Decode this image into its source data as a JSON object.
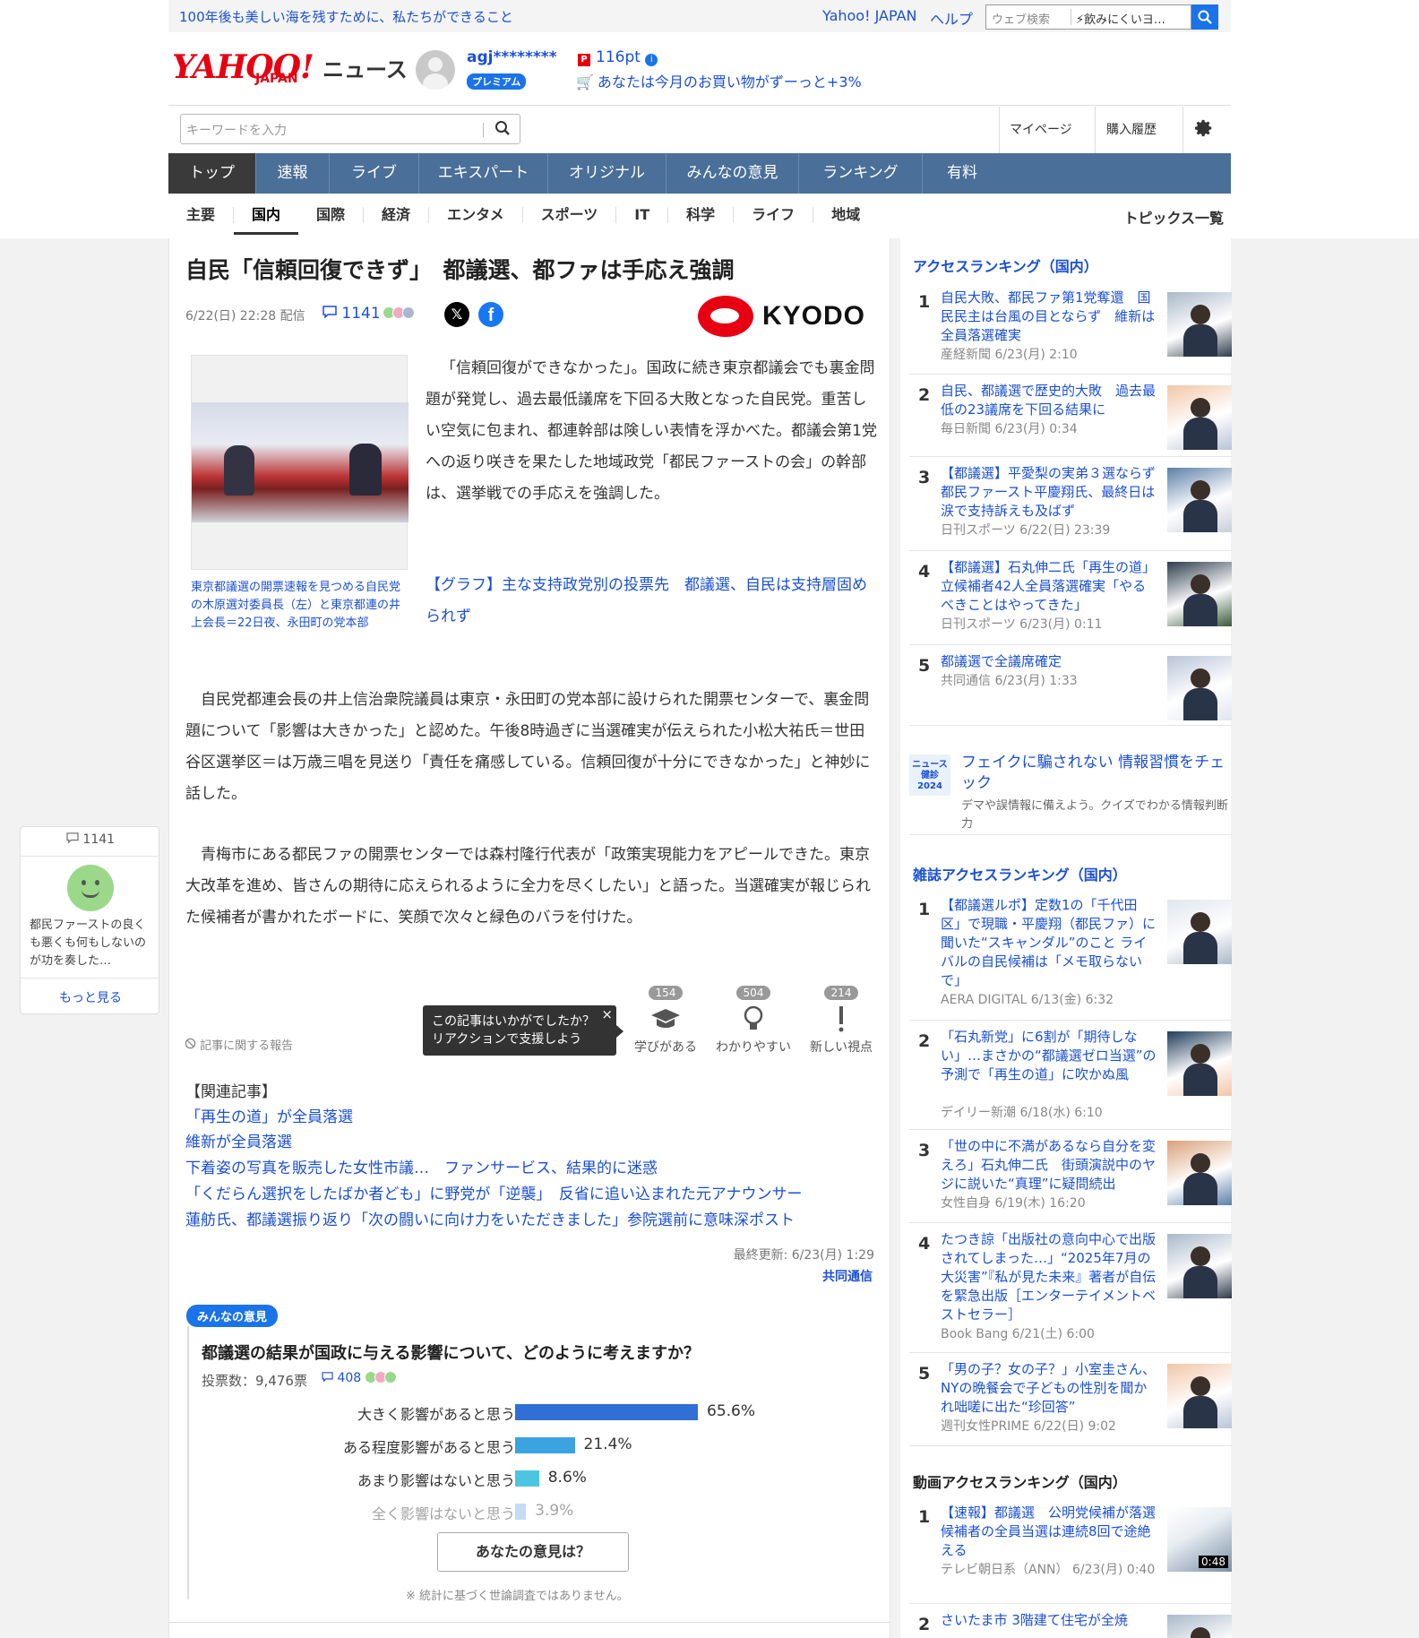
{
  "topbar": {
    "promo": "100年後も美しい海を残すために、私たちができること",
    "yahoo_japan": "Yahoo! JAPAN",
    "help": "ヘルプ",
    "search_placeholder": "ウェブ検索",
    "search_suggest": "飲みにくいヨ…"
  },
  "header": {
    "logo": "YAHOO!",
    "logo_sub": "JAPAN",
    "service": "ニュース",
    "username": "agj********",
    "premium": "プレミアム",
    "points": "116pt",
    "shopping": "あなたは今月のお買い物がずーっと+3%",
    "keyword_placeholder": "キーワードを入力",
    "mypage": "マイページ",
    "purchase_history": "購入履歴"
  },
  "nav": {
    "items": [
      "トップ",
      "速報",
      "ライブ",
      "エキスパート",
      "オリジナル",
      "みんなの意見",
      "ランキング",
      "有料"
    ]
  },
  "subnav": {
    "items": [
      "主要",
      "国内",
      "国際",
      "経済",
      "エンタメ",
      "スポーツ",
      "IT",
      "科学",
      "ライフ",
      "地域"
    ],
    "topics": "トピックス一覧"
  },
  "article": {
    "title": "自民「信頼回復できず」　都議選、都ファは手応え強調",
    "date": "6/22(日) 22:28 配信",
    "comments": "1141",
    "source_logo": "KYODO",
    "caption": "東京都議選の開票速報を見つめる自民党の木原選対委員長（左）と東京都連の井上会長＝22日夜、永田町の党本部",
    "lead": "「信頼回復ができなかった」。国政に続き東京都議会でも裏金問題が発覚し、過去最低議席を下回る大敗となった自民党。重苦しい空気に包まれ、都連幹部は険しい表情を浮かべた。都議会第1党への返り咲きを果たした地域政党「都民ファーストの会」の幹部は、選挙戦での手応えを強調した。",
    "graph_link": "【グラフ】主な支持政党別の投票先　都議選、自民は支持層固められず",
    "para1": "自民党都連会長の井上信治衆院議員は東京・永田町の党本部に設けられた開票センターで、裏金問題について「影響は大きかった」と認めた。午後8時過ぎに当選確実が伝えられた小松大祐氏＝世田谷区選挙区＝は万歳三唱を見送り「責任を痛感している。信頼回復が十分にできなかった」と神妙に話した。",
    "para2": "青梅市にある都民ファの開票センターでは森村隆行代表が「政策実現能力をアピールできた。東京大改革を進め、皆さんの期待に応えられるように全力を尽くしたい」と語った。当選確実が報じられた候補者が書かれたボードに、笑顔で次々と緑色のバラを付けた。",
    "report": "記事に関する報告",
    "tooltip_line1": "この記事はいかがでしたか？",
    "tooltip_line2": "リアクションで支援しよう",
    "reactions": [
      {
        "label": "学びがある",
        "count": "154"
      },
      {
        "label": "わかりやすい",
        "count": "504"
      },
      {
        "label": "新しい視点",
        "count": "214"
      }
    ],
    "related_heading": "【関連記事】",
    "related": [
      "「再生の道」が全員落選",
      "維新が全員落選",
      "下着姿の写真を販売した女性市議…　ファンサービス、結果的に迷惑",
      "「くだらん選択をしたばか者ども」に野党が「逆襲」　反省に追い込まれた元アナウンサー",
      "蓮舫氏、都議選振り返り「次の闘いに向け力をいただきました」参院選前に意味深ポスト"
    ],
    "updated": "最終更新: 6/23(月) 1:29",
    "source_link": "共同通信"
  },
  "comment_float": {
    "count": "1141",
    "text": "都民ファーストの良くも悪くも何もしないのが功を奏した…",
    "more": "もっと見る"
  },
  "poll": {
    "tag": "みんなの意見",
    "question": "都議選の結果が国政に与える影響について、どのように考えますか？",
    "votes": "投票数：9,476票",
    "comments": "408",
    "options": [
      {
        "label": "大きく影響があると思う",
        "value": 65.6,
        "text": "65.6%",
        "color": "#2f6fd6"
      },
      {
        "label": "ある程度影響があると思う",
        "value": 21.4,
        "text": "21.4%",
        "color": "#3aa3e0"
      },
      {
        "label": "あまり影響はないと思う",
        "value": 8.6,
        "text": "8.6%",
        "color": "#4cc6e0"
      },
      {
        "label": "全く影響はないと思う",
        "value": 3.9,
        "text": "3.9%",
        "color": "#7fb0f0"
      }
    ],
    "button": "あなたの意見は？",
    "note": "※ 統計に基づく世論調査ではありません。"
  },
  "sidebar": {
    "access_heading": "アクセスランキング（国内）",
    "access": [
      {
        "rank": "1",
        "title": "自民大敗、都民ファ第1党奪還　国民民主は台風の目とならず　維新は全員落選確実",
        "meta": "産経新聞 6/23(月) 2:10"
      },
      {
        "rank": "2",
        "title": "自民、都議選で歴史的大敗　過去最低の23議席を下回る結果に",
        "meta": "毎日新聞 6/23(月) 0:34"
      },
      {
        "rank": "3",
        "title": "【都議選】平愛梨の実弟３選ならず　都民ファースト平慶翔氏、最終日は涙で支持訴えも及ばず",
        "meta": "日刊スポーツ 6/22(日) 23:39"
      },
      {
        "rank": "4",
        "title": "【都議選】石丸伸二氏「再生の道」立候補者42人全員落選確実「やるべきことはやってきた」",
        "meta": "日刊スポーツ 6/23(月) 0:11"
      },
      {
        "rank": "5",
        "title": "都議選で全議席確定",
        "meta": "共同通信 6/23(月) 1:33"
      }
    ],
    "news24_badge": "ニュース健診2024",
    "news24_title": "フェイクに騙されない 情報習慣をチェック",
    "news24_desc": "デマや誤情報に備えよう。クイズでわかる情報判断力",
    "mag_heading": "雑誌アクセスランキング（国内）",
    "mag": [
      {
        "rank": "1",
        "title": "【都議選ルポ】定数1の「千代田区」で現職・平慶翔（都民ファ）に聞いた“スキャンダル”のこと ライバルの自民候補は「メモ取らないで」",
        "meta": "AERA DIGITAL 6/13(金) 6:32"
      },
      {
        "rank": "2",
        "title": "「石丸新党」に6割が「期待しない」…まさかの“都議選ゼロ当選”の予測で「再生の道」に吹かぬ風",
        "meta": "デイリー新潮 6/18(水) 6:10"
      },
      {
        "rank": "3",
        "title": "「世の中に不満があるなら自分を変えろ」石丸伸二氏　街頭演説中のヤジに説いた“真理”に疑問続出",
        "meta": "女性自身 6/19(木) 16:20"
      },
      {
        "rank": "4",
        "title": "たつき諒「出版社の意向中心で出版されてしまった…」“2025年7月の大災害”『私が見た未来』著者が自伝を緊急出版［エンターテイメントベストセラー］",
        "meta": "Book Bang 6/21(土) 6:00"
      },
      {
        "rank": "5",
        "title": "「男の子？女の子？」小室圭さん、NYの晩餐会で子どもの性別を聞かれ咄嗟に出た“珍回答”",
        "meta": "週刊女性PRIME 6/22(日) 9:02"
      }
    ],
    "video_heading": "動画アクセスランキング（国内）",
    "video": [
      {
        "rank": "1",
        "title": "【速報】都議選　公明党候補が落選　候補者の全員当選は連続8回で途絶える",
        "meta": "テレビ朝日系（ANN） 6/23(月) 0:40",
        "duration": "0:48"
      },
      {
        "rank": "2",
        "title": "さいたま市 3階建て住宅が全焼",
        "meta": ""
      }
    ]
  }
}
